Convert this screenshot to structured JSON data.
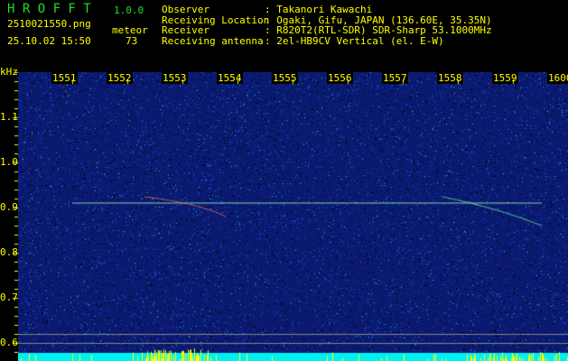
{
  "app": {
    "name": "H R O F F T",
    "version": "1.0.0"
  },
  "file": {
    "name": "2510021550.png",
    "datetime": "25.10.02 15:50"
  },
  "meteor": {
    "label": "meteor",
    "count": "73"
  },
  "info": [
    {
      "label": "Observer",
      "value": ": Takanori Kawachi"
    },
    {
      "label": "Receiving Location",
      "value": ": Ogaki, Gifu, JAPAN (136.60E, 35.35N)"
    },
    {
      "label": "Receiver",
      "value": ": R820T2(RTL-SDR) SDR-Sharp 53.1000MHz"
    },
    {
      "label": "Receiving antenna",
      "value": ": 2el-HB9CV Vertical (el. E-W)"
    }
  ],
  "axis": {
    "unit": "kHz",
    "x_ticks": [
      "1551",
      "1552",
      "1553",
      "1554",
      "1555",
      "1556",
      "1557",
      "1558",
      "1559",
      "1600"
    ],
    "y_ticks": [
      "1.1",
      "1.0",
      "0.9",
      "0.8",
      "0.7",
      "0.6"
    ]
  }
}
